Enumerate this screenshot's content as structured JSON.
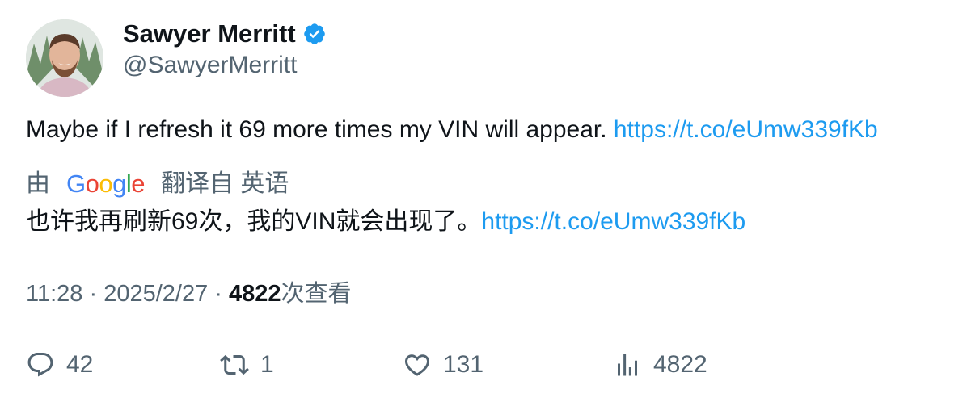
{
  "author": {
    "display_name": "Sawyer Merritt",
    "handle": "@SawyerMerritt",
    "verified_icon": "verified-badge-icon",
    "verified_color": "#1d9bf0"
  },
  "tweet": {
    "text": "Maybe if I refresh it 69 more times my VIN will appear. ",
    "link": "https://t.co/eUmw339fKb"
  },
  "translation": {
    "by_prefix": "由",
    "google_letters": [
      "G",
      "o",
      "o",
      "g",
      "l",
      "e"
    ],
    "suffix": "翻译自 英语",
    "text": "也许我再刷新69次，我的VIN就会出现了。",
    "link": "https://t.co/eUmw339fKb"
  },
  "meta": {
    "time": "11:28",
    "date": "2025/2/27",
    "separator": " · ",
    "views_count": "4822",
    "views_label": "次查看"
  },
  "actions": {
    "replies": "42",
    "retweets": "1",
    "likes": "131",
    "views": "4822"
  },
  "colors": {
    "text": "#0f1419",
    "secondary": "#536471",
    "link": "#1d9bf0"
  }
}
